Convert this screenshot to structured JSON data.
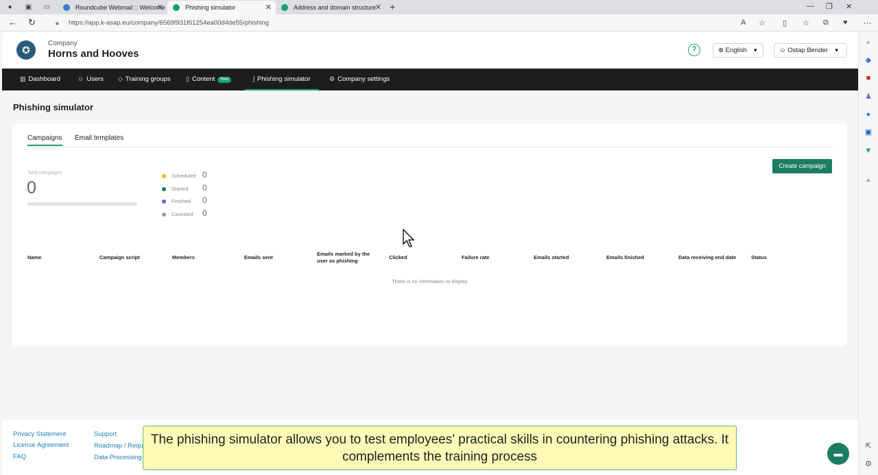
{
  "browser": {
    "tabs": [
      {
        "title": "Roundcube Webmail :: Welcome",
        "active": false,
        "icon_color": "#3a7bd5"
      },
      {
        "title": "Phishing simulator",
        "active": true,
        "icon_color": "#1a9e73"
      },
      {
        "title": "Address and domain structure",
        "active": false,
        "icon_color": "#1a9e73"
      }
    ],
    "url": "https://app.k-asap.eu/company/6569f931f61254ea00d4de55/phishing"
  },
  "header": {
    "company_label": "Company",
    "company_name": "Horns and Hooves",
    "help": "?",
    "language": "English",
    "user": "Ostap Bender"
  },
  "nav": {
    "items": [
      {
        "label": "Dashboard",
        "icon": "bar-chart-icon"
      },
      {
        "label": "Users",
        "icon": "user-icon"
      },
      {
        "label": "Training groups",
        "icon": "graduation-icon"
      },
      {
        "label": "Content",
        "icon": "book-icon",
        "badge": "New"
      },
      {
        "label": "Phishing simulator",
        "icon": "hook-icon",
        "active": true
      },
      {
        "label": "Company settings",
        "icon": "gear-icon"
      }
    ]
  },
  "page": {
    "title": "Phishing simulator",
    "tabs": [
      "Campaigns",
      "Email templates"
    ],
    "total_label": "Total campaigns",
    "total_value": "0",
    "progress": 0,
    "stats": [
      {
        "label": "Scheduled",
        "value": "0",
        "color": "#f0b400"
      },
      {
        "label": "Started",
        "value": "0",
        "color": "#1c7d60"
      },
      {
        "label": "Finished",
        "value": "0",
        "color": "#7b5cf0"
      },
      {
        "label": "Canceled",
        "value": "0",
        "color": "#9a9a9f"
      }
    ],
    "create_button": "Create campaign",
    "table": {
      "columns": [
        "Name",
        "Campaign script",
        "Members",
        "Emails sent",
        "Emails marked by the user as phishing",
        "Clicked",
        "Failure rate",
        "Emails started",
        "Emails finished",
        "Data receiving end date",
        "Status"
      ],
      "empty_text": "There is no information to display"
    }
  },
  "footer": {
    "col1": [
      "Privacy Statement",
      "License Agreement",
      "FAQ"
    ],
    "col2": [
      "Support",
      "Roadmap / Requ",
      "Data Processing"
    ]
  },
  "caption": "The phishing simulator allows you to test employees' practical skills in countering phishing attacks. It complements the training process",
  "colors": {
    "accent": "#1a9e73",
    "nav_bg": "#1d1d1f",
    "button": "#1c7d60"
  }
}
